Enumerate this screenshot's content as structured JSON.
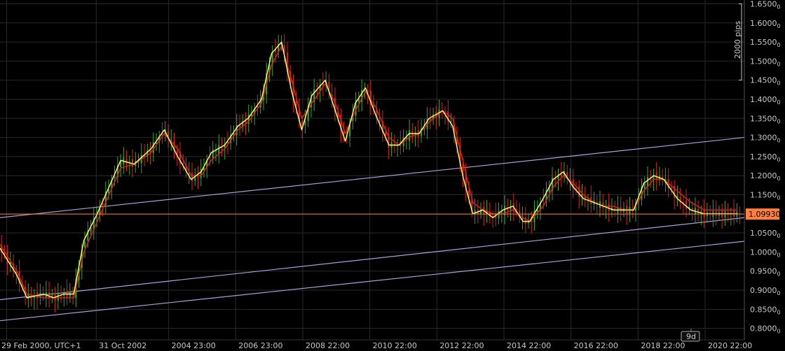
{
  "chart_data": {
    "type": "candlestick",
    "title": "",
    "xlabel": "",
    "ylabel": "",
    "ylim": [
      0.77,
      1.66
    ],
    "grid": true,
    "y_ticks": [
      {
        "value": 1.65,
        "label": "1.6500"
      },
      {
        "value": 1.6,
        "label": "1.6000"
      },
      {
        "value": 1.55,
        "label": "1.5500"
      },
      {
        "value": 1.5,
        "label": "1.5000"
      },
      {
        "value": 1.45,
        "label": "1.4500"
      },
      {
        "value": 1.4,
        "label": "1.4000"
      },
      {
        "value": 1.35,
        "label": "1.3500"
      },
      {
        "value": 1.3,
        "label": "1.3000"
      },
      {
        "value": 1.25,
        "label": "1.2500"
      },
      {
        "value": 1.2,
        "label": "1.2000"
      },
      {
        "value": 1.15,
        "label": "1.1500"
      },
      {
        "value": 1.05,
        "label": "1.0500"
      },
      {
        "value": 1.0,
        "label": "1.0000"
      },
      {
        "value": 0.95,
        "label": "0.9500"
      },
      {
        "value": 0.9,
        "label": "0.9000"
      },
      {
        "value": 0.85,
        "label": "0.8500"
      },
      {
        "value": 0.8,
        "label": "0.8000"
      }
    ],
    "y_tick_suffix": "0",
    "x_ticks": [
      {
        "t": 0.0,
        "label": "29 Feb 2000, UTC+1"
      },
      {
        "t": 2.67,
        "label": "31 Oct 2002"
      },
      {
        "t": 4.83,
        "label": "2004 23:00"
      },
      {
        "t": 6.83,
        "label": "2006 23:00"
      },
      {
        "t": 8.83,
        "label": "2008 22:00"
      },
      {
        "t": 10.83,
        "label": "2010 22:00"
      },
      {
        "t": 12.83,
        "label": "2012 22:00"
      },
      {
        "t": 14.83,
        "label": "2014 22:00"
      },
      {
        "t": 16.83,
        "label": "2016 22:00"
      },
      {
        "t": 18.83,
        "label": "2018 22:00"
      },
      {
        "t": 20.83,
        "label": "2020 22:00"
      }
    ],
    "x_unit": "years since 29 Feb 2000",
    "xlim": [
      -0.2,
      22.0
    ],
    "series": [
      {
        "name": "",
        "color": "#ffff66",
        "x": [
          -0.2,
          0.3,
          0.6,
          1.1,
          1.4,
          1.7,
          2.0,
          2.3,
          2.7,
          3.0,
          3.4,
          3.8,
          4.3,
          4.7,
          5.1,
          5.5,
          5.8,
          6.1,
          6.5,
          6.9,
          7.2,
          7.6,
          7.9,
          8.2,
          8.5,
          8.8,
          9.1,
          9.5,
          9.8,
          10.1,
          10.4,
          10.7,
          11.0,
          11.4,
          11.7,
          12.0,
          12.3,
          12.6,
          13.0,
          13.3,
          13.6,
          13.9,
          14.2,
          14.5,
          14.8,
          15.1,
          15.4,
          15.6,
          16.0,
          16.3,
          16.6,
          16.9,
          17.2,
          17.5,
          17.8,
          18.1,
          18.4,
          18.7,
          19.0,
          19.3,
          19.6,
          20.0,
          20.4,
          20.8,
          21.1,
          21.5,
          21.8
        ],
        "values": [
          1.01,
          0.94,
          0.88,
          0.89,
          0.88,
          0.89,
          0.89,
          1.03,
          1.1,
          1.16,
          1.24,
          1.23,
          1.27,
          1.32,
          1.25,
          1.19,
          1.21,
          1.26,
          1.28,
          1.33,
          1.35,
          1.4,
          1.52,
          1.55,
          1.42,
          1.32,
          1.41,
          1.45,
          1.37,
          1.29,
          1.39,
          1.43,
          1.36,
          1.28,
          1.28,
          1.31,
          1.31,
          1.35,
          1.37,
          1.33,
          1.2,
          1.1,
          1.11,
          1.09,
          1.11,
          1.12,
          1.08,
          1.08,
          1.14,
          1.19,
          1.21,
          1.17,
          1.14,
          1.13,
          1.12,
          1.11,
          1.11,
          1.11,
          1.18,
          1.2,
          1.19,
          1.14,
          1.11,
          1.1,
          1.1,
          1.1,
          1.1
        ]
      },
      {
        "name": "",
        "color": "#e02020",
        "x": [
          -0.2,
          0.3,
          0.6,
          1.1,
          1.4,
          1.7,
          2.0,
          2.3,
          2.7,
          3.0,
          3.4,
          3.8,
          4.3,
          4.7,
          5.1,
          5.5,
          5.8,
          6.1,
          6.5,
          6.9,
          7.2,
          7.6,
          7.9,
          8.2,
          8.5,
          8.8,
          9.1,
          9.5,
          9.8,
          10.1,
          10.4,
          10.7,
          11.0,
          11.4,
          11.7,
          12.0,
          12.3,
          12.6,
          13.0,
          13.3,
          13.6,
          13.9,
          14.2,
          14.5,
          14.8,
          15.1,
          15.4,
          15.6,
          16.0,
          16.3,
          16.6,
          16.9,
          17.2,
          17.5,
          17.8,
          18.1,
          18.4,
          18.7,
          19.0,
          19.3,
          19.6,
          20.0,
          20.4,
          20.8,
          21.1,
          21.5,
          21.8
        ],
        "values": [
          1.02,
          0.95,
          0.89,
          0.88,
          0.88,
          0.88,
          0.88,
          1.0,
          1.08,
          1.14,
          1.22,
          1.23,
          1.26,
          1.31,
          1.27,
          1.2,
          1.2,
          1.24,
          1.27,
          1.32,
          1.34,
          1.39,
          1.49,
          1.54,
          1.45,
          1.35,
          1.39,
          1.44,
          1.39,
          1.31,
          1.37,
          1.42,
          1.38,
          1.3,
          1.28,
          1.3,
          1.31,
          1.34,
          1.37,
          1.35,
          1.24,
          1.13,
          1.11,
          1.1,
          1.1,
          1.11,
          1.09,
          1.08,
          1.12,
          1.17,
          1.2,
          1.18,
          1.15,
          1.13,
          1.12,
          1.12,
          1.11,
          1.11,
          1.16,
          1.19,
          1.19,
          1.16,
          1.13,
          1.11,
          1.11,
          1.11,
          1.11
        ]
      }
    ],
    "candles": {
      "up_color": "#33aa33",
      "down_color": "#dd2222",
      "note": "candle OHLC derived from the series values plus a fixed jitter pattern"
    },
    "current_price": {
      "value": 1.0993,
      "label": "1.09930",
      "color": "#ff7f3f"
    },
    "channels": [
      {
        "color": "#b19cd9",
        "p1": {
          "t": -0.2,
          "v": 1.09
        },
        "p2": {
          "t": 22.0,
          "v": 1.3
        }
      },
      {
        "color": "#b19cd9",
        "p1": {
          "t": -0.2,
          "v": 0.875
        },
        "p2": {
          "t": 22.0,
          "v": 1.09
        }
      },
      {
        "color": "#b19cd9",
        "p1": {
          "t": -0.2,
          "v": 0.82
        },
        "p2": {
          "t": 22.0,
          "v": 1.028
        }
      }
    ],
    "scale_marker": {
      "label": "2000 pips",
      "from": 1.45,
      "to": 1.65
    },
    "period_marker": {
      "label": "9d"
    }
  }
}
